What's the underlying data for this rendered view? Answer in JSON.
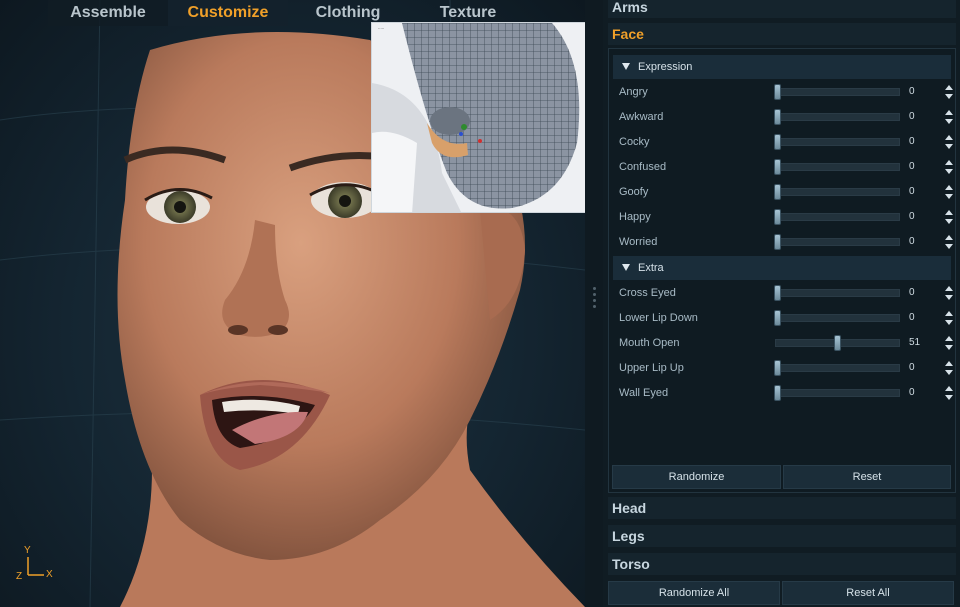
{
  "tabs": [
    "Assemble",
    "Customize",
    "Clothing",
    "Texture"
  ],
  "active_tab": "Customize",
  "axis": {
    "y": "Y",
    "x": "X",
    "z": "Z"
  },
  "categories": {
    "arms": "Arms",
    "face": "Face",
    "head": "Head",
    "legs": "Legs",
    "torso": "Torso"
  },
  "face": {
    "expression": {
      "title": "Expression",
      "sliders": [
        {
          "label": "Angry",
          "value": "0"
        },
        {
          "label": "Awkward",
          "value": "0"
        },
        {
          "label": "Cocky",
          "value": "0"
        },
        {
          "label": "Confused",
          "value": "0"
        },
        {
          "label": "Goofy",
          "value": "0"
        },
        {
          "label": "Happy",
          "value": "0"
        },
        {
          "label": "Worried",
          "value": "0"
        }
      ]
    },
    "extra": {
      "title": "Extra",
      "sliders": [
        {
          "label": "Cross Eyed",
          "value": "0"
        },
        {
          "label": "Lower Lip Down",
          "value": "0"
        },
        {
          "label": "Mouth Open",
          "value": "51"
        },
        {
          "label": "Upper Lip Up",
          "value": "0"
        },
        {
          "label": "Wall Eyed",
          "value": "0"
        }
      ]
    },
    "randomize_label": "Randomize",
    "reset_label": "Reset"
  },
  "footer": {
    "randomize_all_label": "Randomize All",
    "reset_all_label": "Reset All"
  },
  "colors": {
    "accent": "#f0a029",
    "skin": "#c98a6a",
    "panel": "#101c23"
  }
}
